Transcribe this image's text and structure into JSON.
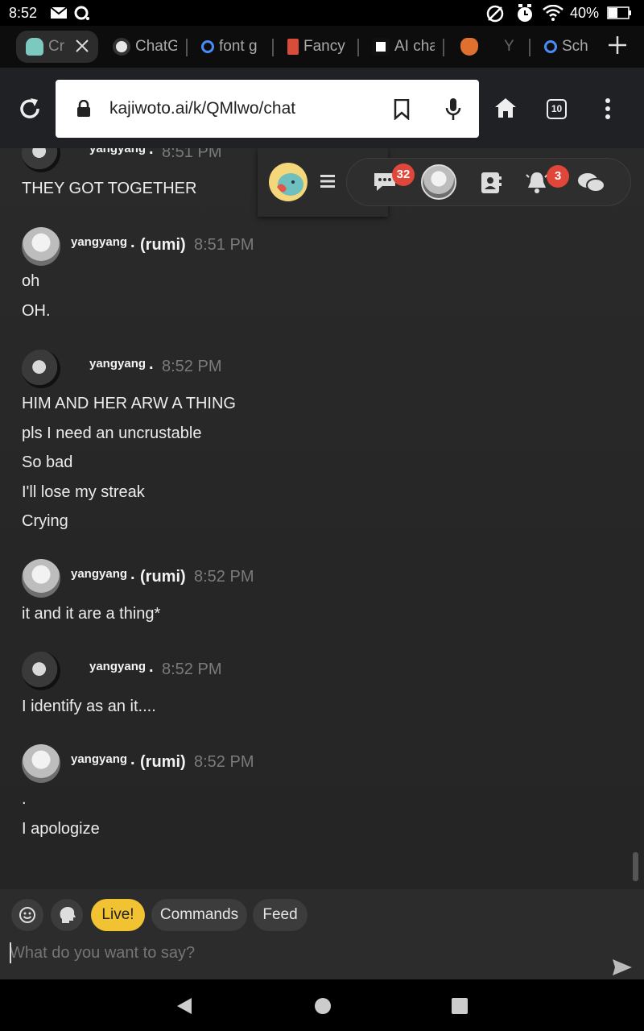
{
  "status_bar": {
    "time": "8:52",
    "battery": "40%"
  },
  "tabs": [
    {
      "label": "Cr",
      "favicon": "ghost-favicon",
      "color": "#7cc9c0",
      "active": true
    },
    {
      "label": "ChatG",
      "favicon": "openai-favicon",
      "color": "#e6e6e6"
    },
    {
      "label": "font g",
      "favicon": "search-favicon",
      "color": "#4a8cf7"
    },
    {
      "label": "Fancy",
      "favicon": "fancy-favicon",
      "color": "#d84c3a"
    },
    {
      "label": "AI cha",
      "favicon": "ai-favicon",
      "color": "#ffffff"
    },
    {
      "label": "",
      "favicon": "flame-favicon",
      "color": "#e07030"
    },
    {
      "label": "Y",
      "favicon": "",
      "color": "#666"
    },
    {
      "label": "Sch",
      "favicon": "search-favicon",
      "color": "#4a8cf7"
    }
  ],
  "toolbar": {
    "url": "kajiwoto.ai/k/QMlwo/chat",
    "tab_count": "10"
  },
  "nav": {
    "messages_badge": "32",
    "notifications_badge": "3"
  },
  "messages": [
    {
      "user": "yangyang",
      "alias": "",
      "time": "8:51 PM",
      "avatar": "dark",
      "lines": [
        "THEY GOT TOGETHER"
      ]
    },
    {
      "user": "yangyang",
      "alias": "(rumi)",
      "time": "8:51 PM",
      "avatar": "light",
      "lines": [
        "oh",
        "OH."
      ]
    },
    {
      "user": "yangyang",
      "alias": "",
      "time": "8:52 PM",
      "avatar": "dark",
      "lines": [
        "HIM AND HER ARW A THING",
        "pls I need an uncrustable",
        "So bad",
        "I'll lose my streak",
        "Crying"
      ]
    },
    {
      "user": "yangyang",
      "alias": "(rumi)",
      "time": "8:52 PM",
      "avatar": "light",
      "lines": [
        "it and it are a thing*"
      ]
    },
    {
      "user": "yangyang",
      "alias": "",
      "time": "8:52 PM",
      "avatar": "dark",
      "lines": [
        "I identify as an it...."
      ]
    },
    {
      "user": "yangyang",
      "alias": "(rumi)",
      "time": "8:52 PM",
      "avatar": "light",
      "lines": [
        ".",
        "I apologize"
      ]
    }
  ],
  "composer": {
    "live_label": "Live!",
    "commands_label": "Commands",
    "feed_label": "Feed",
    "placeholder": "What do you want to say?"
  }
}
